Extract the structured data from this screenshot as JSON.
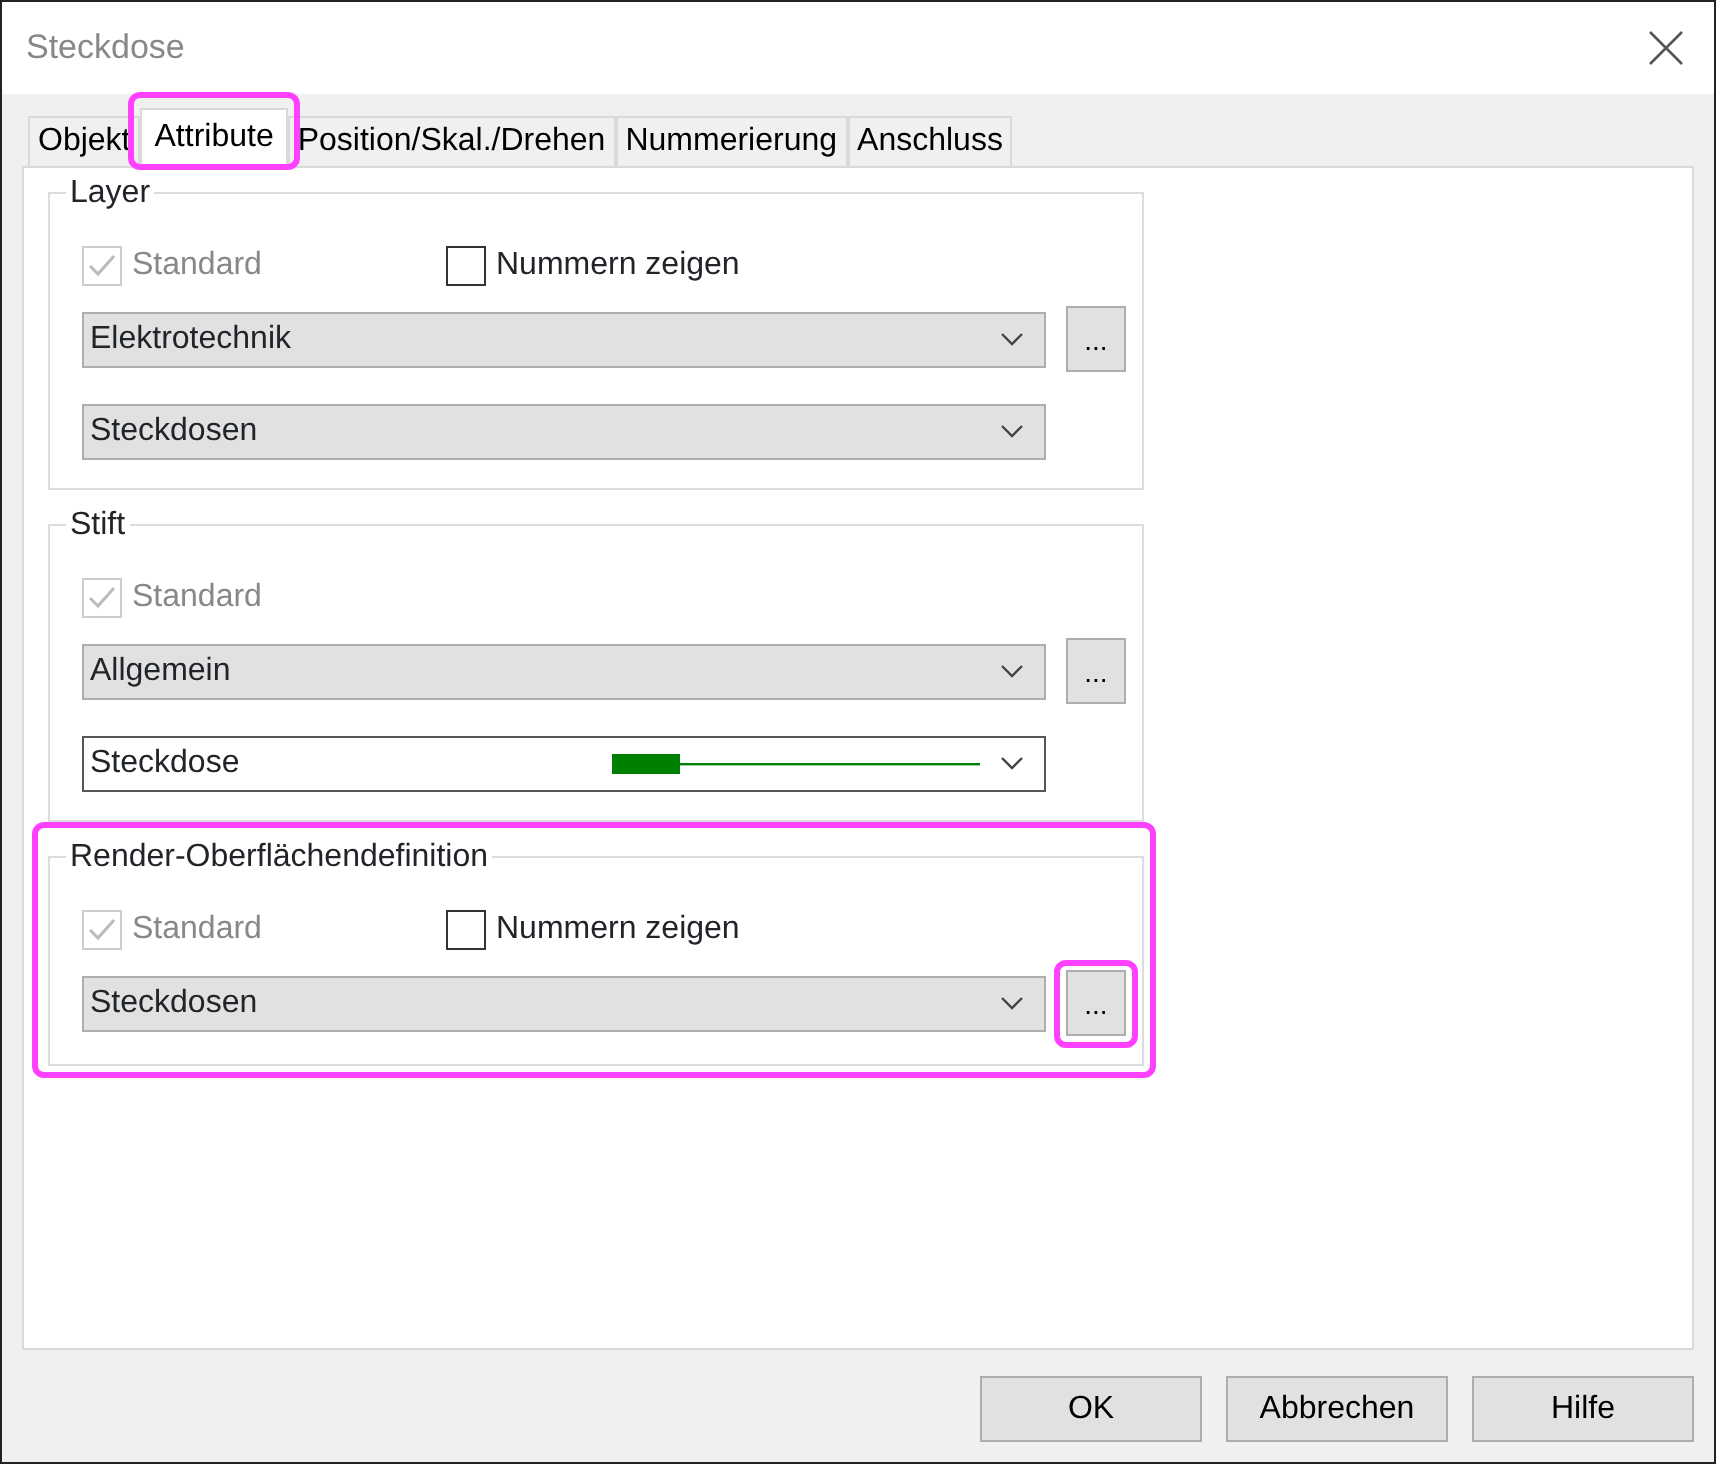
{
  "window": {
    "title": "Steckdose"
  },
  "tabs": [
    {
      "label": "Objekt",
      "selected": false,
      "highlighted": false
    },
    {
      "label": "Attribute",
      "selected": true,
      "highlighted": true
    },
    {
      "label": "Position/Skal./Drehen",
      "selected": false,
      "highlighted": false
    },
    {
      "label": "Nummerierung",
      "selected": false,
      "highlighted": false
    },
    {
      "label": "Anschluss",
      "selected": false,
      "highlighted": false
    }
  ],
  "groups": [
    {
      "title": "Layer",
      "highlighted": false,
      "standard": {
        "label": "Standard",
        "checked": true,
        "disabled": true
      },
      "show_numbers": {
        "label": "Nummern zeigen",
        "checked": false
      },
      "dropdowns": [
        {
          "kind": "combo",
          "value": "Elektrotechnik",
          "button": {
            "label": "...",
            "highlighted": false
          }
        },
        {
          "kind": "combo",
          "value": "Steckdosen"
        }
      ]
    },
    {
      "title": "Stift",
      "highlighted": false,
      "standard": {
        "label": "Standard",
        "checked": true,
        "disabled": true
      },
      "dropdowns": [
        {
          "kind": "combo",
          "value": "Allgemein",
          "button": {
            "label": "...",
            "highlighted": false
          }
        },
        {
          "kind": "pen",
          "value": "Steckdose"
        }
      ]
    },
    {
      "title": "Render-Oberflächendefinition",
      "highlighted": true,
      "standard": {
        "label": "Standard",
        "checked": true,
        "disabled": true
      },
      "show_numbers": {
        "label": "Nummern zeigen",
        "checked": false
      },
      "dropdowns": [
        {
          "kind": "combo",
          "value": "Steckdosen",
          "button": {
            "label": "...",
            "highlighted": true
          }
        }
      ]
    }
  ],
  "buttons": [
    "OK",
    "Abbrechen",
    "Hilfe"
  ]
}
